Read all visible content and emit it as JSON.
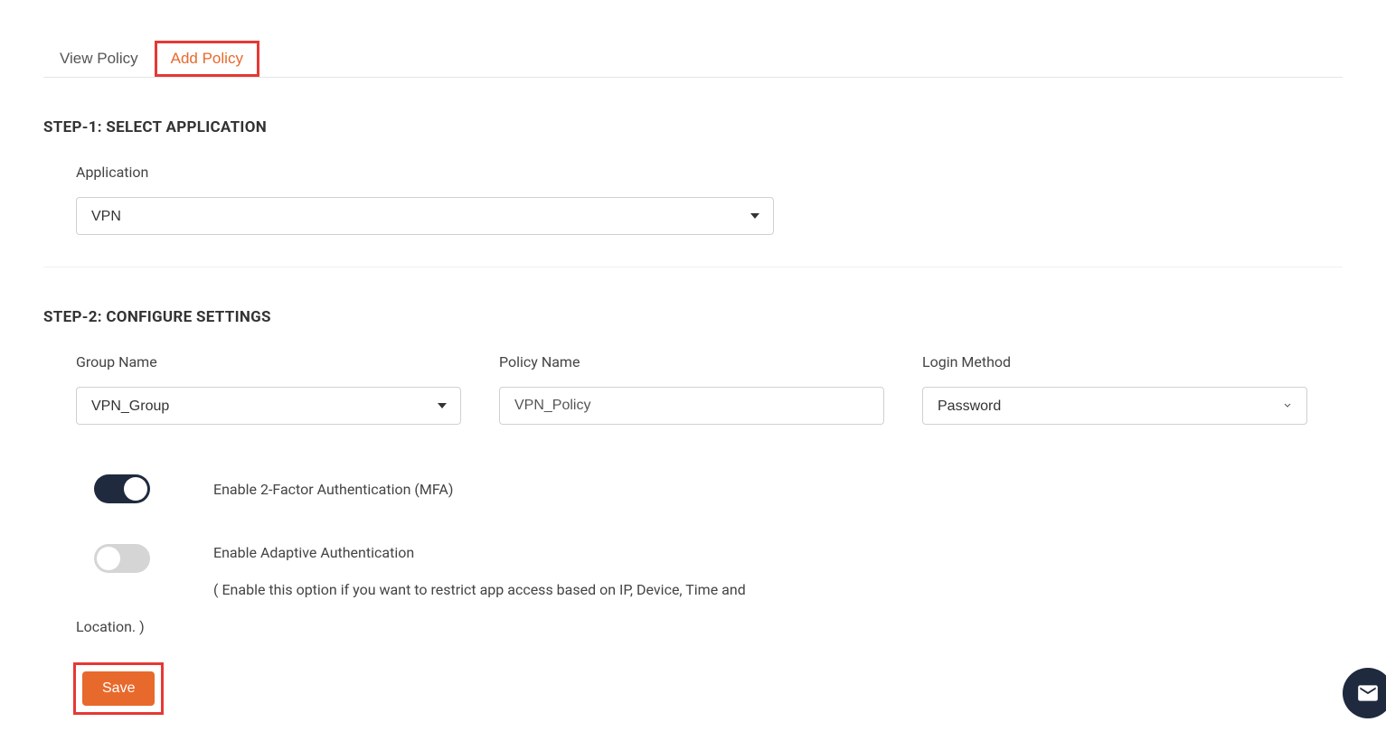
{
  "tabs": {
    "view_policy": "View Policy",
    "add_policy": "Add Policy"
  },
  "step1": {
    "heading": "STEP-1: SELECT APPLICATION",
    "application_label": "Application",
    "application_value": "VPN"
  },
  "step2": {
    "heading": "STEP-2: CONFIGURE SETTINGS",
    "group_name_label": "Group Name",
    "group_name_value": "VPN_Group",
    "policy_name_label": "Policy Name",
    "policy_name_value": "VPN_Policy",
    "login_method_label": "Login Method",
    "login_method_value": "Password",
    "mfa_label": "Enable 2-Factor Authentication (MFA)",
    "adaptive_label": "Enable Adaptive Authentication",
    "adaptive_desc_line1": "( Enable this option if you want to restrict app access based on IP, Device, Time and",
    "adaptive_desc_line2": "Location. )"
  },
  "buttons": {
    "save": "Save"
  }
}
